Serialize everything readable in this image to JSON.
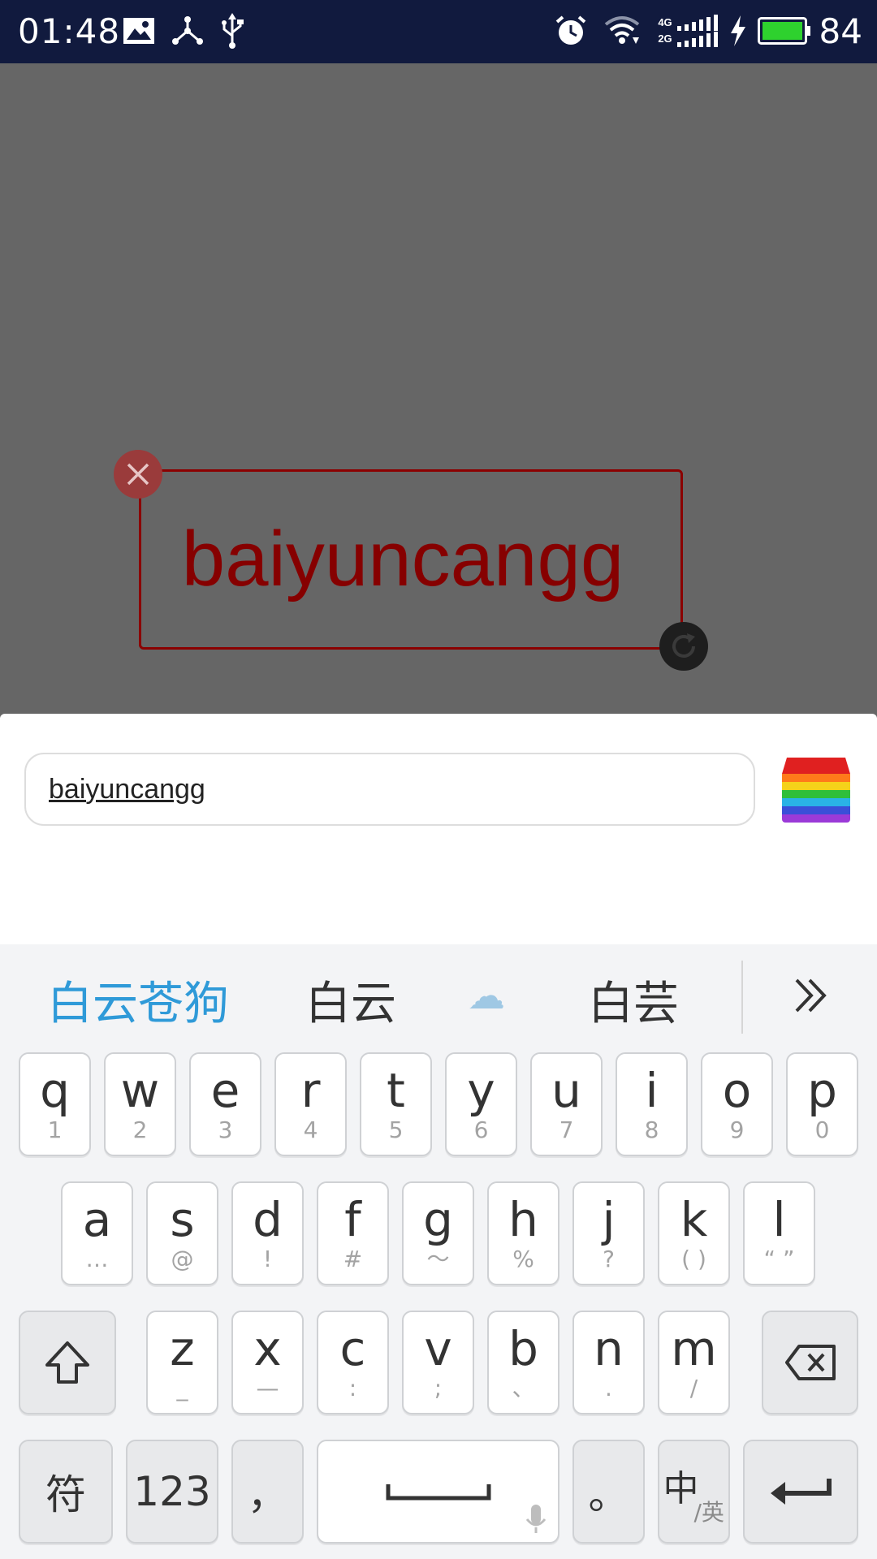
{
  "status_bar": {
    "time": "01:48",
    "battery_percent": "84",
    "network_labels": [
      "4G",
      "2G"
    ],
    "icons": [
      "image-icon",
      "share-nodes-icon",
      "usb-icon",
      "alarm-icon",
      "wifi-icon",
      "signal-icon",
      "charging-icon",
      "battery-icon"
    ]
  },
  "sticker": {
    "text": "baiyuncangg",
    "text_color": "#860000",
    "close_icon": "close-icon",
    "rotate_icon": "rotate-icon"
  },
  "input_panel": {
    "value": "baiyuncangg",
    "color_picker_icon": "rainbow-color-icon"
  },
  "keyboard": {
    "candidates": [
      "白云苍狗",
      "白云",
      "☁",
      "白芸"
    ],
    "more_icon": "double-chevron-right-icon",
    "row1": [
      {
        "main": "q",
        "sub": "1"
      },
      {
        "main": "w",
        "sub": "2"
      },
      {
        "main": "e",
        "sub": "3"
      },
      {
        "main": "r",
        "sub": "4"
      },
      {
        "main": "t",
        "sub": "5"
      },
      {
        "main": "y",
        "sub": "6"
      },
      {
        "main": "u",
        "sub": "7"
      },
      {
        "main": "i",
        "sub": "8"
      },
      {
        "main": "o",
        "sub": "9"
      },
      {
        "main": "p",
        "sub": "0"
      }
    ],
    "row2": [
      {
        "main": "a",
        "sub": "…"
      },
      {
        "main": "s",
        "sub": "@"
      },
      {
        "main": "d",
        "sub": "!"
      },
      {
        "main": "f",
        "sub": "#"
      },
      {
        "main": "g",
        "sub": "～"
      },
      {
        "main": "h",
        "sub": "%"
      },
      {
        "main": "j",
        "sub": "?"
      },
      {
        "main": "k",
        "sub": "( )"
      },
      {
        "main": "l",
        "sub": "“ ”"
      }
    ],
    "row3": [
      {
        "main": "z",
        "sub": "_"
      },
      {
        "main": "x",
        "sub": "—"
      },
      {
        "main": "c",
        "sub": ":"
      },
      {
        "main": "v",
        "sub": ";"
      },
      {
        "main": "b",
        "sub": "、"
      },
      {
        "main": "n",
        "sub": "."
      },
      {
        "main": "m",
        "sub": "/"
      }
    ],
    "shift_icon": "shift-icon",
    "backspace_icon": "backspace-icon",
    "symbols_label": "符",
    "numbers_label": "123",
    "comma_label": "，",
    "space_icon": "space-bar-icon",
    "mic_icon": "microphone-icon",
    "period_label": "。",
    "lang_main": "中",
    "lang_sub": "/英",
    "enter_icon": "enter-icon"
  }
}
